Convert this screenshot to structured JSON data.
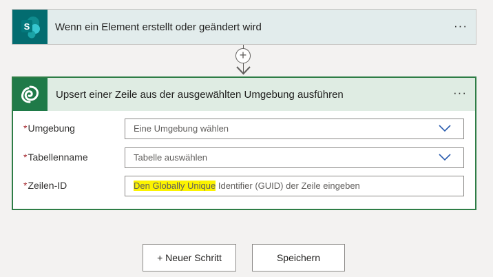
{
  "trigger": {
    "title": "Wenn ein Element erstellt oder geändert wird",
    "icon": "sharepoint-icon",
    "icon_letter": "S",
    "more": "···"
  },
  "connector": {
    "add_symbol": "+",
    "arrow_icon": "chevron-down-icon"
  },
  "action": {
    "title": "Upsert einer Zeile aus der ausgewählten Umgebung ausführen",
    "icon": "dataverse-icon",
    "more": "···",
    "fields": [
      {
        "required": "*",
        "label": "Umgebung",
        "placeholder": "Eine Umgebung wählen",
        "type": "dropdown"
      },
      {
        "required": "*",
        "label": "Tabellenname",
        "placeholder": "Tabelle auswählen",
        "type": "dropdown"
      },
      {
        "required": "*",
        "label": "Zeilen-ID",
        "placeholder_highlighted": "Den Globally Unique",
        "placeholder_rest": " Identifier (GUID) der Zeile eingeben",
        "type": "text"
      }
    ]
  },
  "buttons": {
    "new_step": "+ Neuer Schritt",
    "save": "Speichern"
  },
  "colors": {
    "sharepoint": "#036c70",
    "dataverse": "#1f7a48",
    "action_border": "#2e7d46",
    "highlight": "#fcf300",
    "chevron": "#2a5cae"
  }
}
